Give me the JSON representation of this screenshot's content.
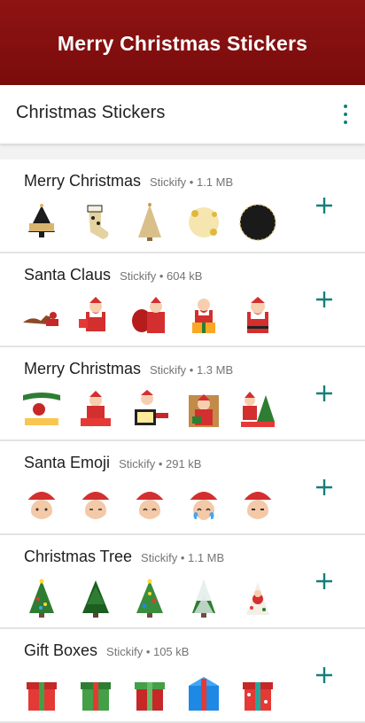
{
  "banner": {
    "title": "Merry Christmas Stickers"
  },
  "appbar": {
    "title": "Christmas Stickers",
    "menu_icon": "more-vert-icon"
  },
  "colors": {
    "banner": "#8a1010",
    "accent": "#137f7a"
  },
  "packs": [
    {
      "name": "Merry Christmas",
      "meta": "Stickify • 1.1 MB",
      "stickers": [
        "merry-christmas-tree-sticker",
        "stocking-sticker",
        "merry-xmas-tree-sticker",
        "holly-jolly-sticker",
        "xmas-joy-sticker"
      ]
    },
    {
      "name": "Santa Claus",
      "meta": "Stickify • 604 kB",
      "stickers": [
        "sleigh-reindeer-sticker",
        "santa-gift-sticker",
        "santa-sack-sticker",
        "santa-presents-sticker",
        "santa-waving-sticker"
      ]
    },
    {
      "name": "Merry Christmas",
      "meta": "Stickify • 1.3 MB",
      "stickers": [
        "merry-christmas-wreath-sticker",
        "santa-merry-christmas-sticker",
        "santa-sign-sticker",
        "santa-chair-sticker",
        "santa-tree-sticker"
      ]
    },
    {
      "name": "Santa Emoji",
      "meta": "Stickify • 291 kB",
      "stickers": [
        "santa-emoji-neutral-sticker",
        "santa-emoji-smirk-sticker",
        "santa-emoji-smile-sticker",
        "santa-emoji-crying-sticker",
        "santa-emoji-meh-sticker"
      ]
    },
    {
      "name": "Christmas Tree",
      "meta": "Stickify • 1.1 MB",
      "stickers": [
        "decorated-tree-sticker",
        "green-tree-sticker",
        "ornament-tree-sticker",
        "snowy-tree-sticker",
        "santa-tree-topper-sticker"
      ]
    },
    {
      "name": "Gift Boxes",
      "meta": "Stickify • 105 kB",
      "stickers": [
        "red-gift-box-sticker",
        "green-gift-box-sticker",
        "red-green-gift-sticker",
        "blue-gift-box-sticker",
        "polka-gift-box-sticker"
      ]
    }
  ]
}
